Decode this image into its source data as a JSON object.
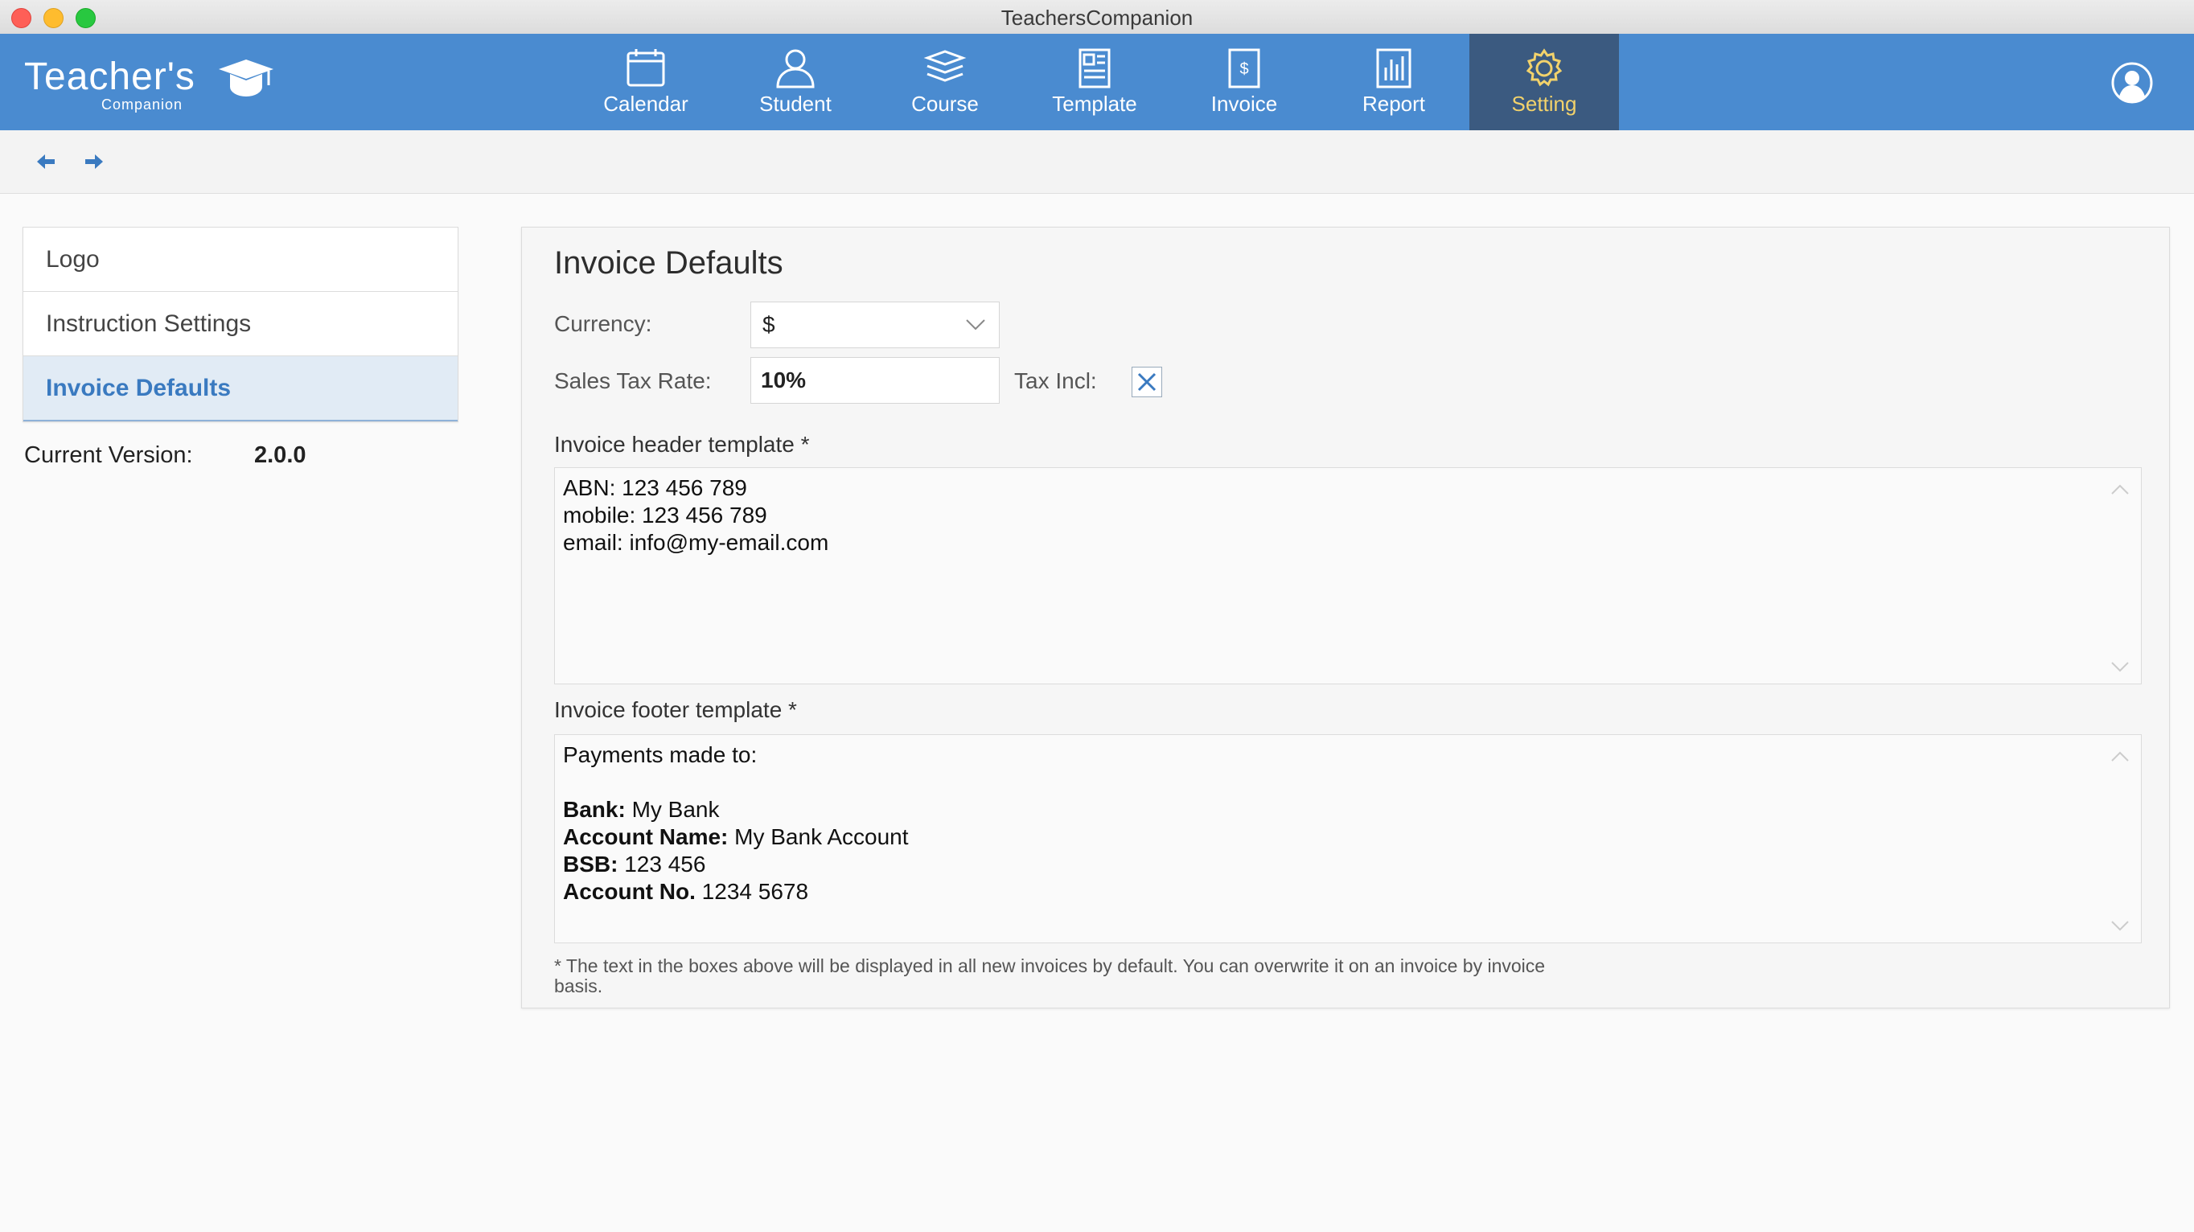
{
  "window": {
    "title": "TeachersCompanion"
  },
  "brand": {
    "name": "Teacher's",
    "subtitle": "Companion"
  },
  "nav": {
    "items": [
      {
        "label": "Calendar",
        "icon": "calendar-icon"
      },
      {
        "label": "Student",
        "icon": "student-icon"
      },
      {
        "label": "Course",
        "icon": "course-icon"
      },
      {
        "label": "Template",
        "icon": "template-icon"
      },
      {
        "label": "Invoice",
        "icon": "invoice-icon"
      },
      {
        "label": "Report",
        "icon": "report-icon"
      },
      {
        "label": "Setting",
        "icon": "gear-icon"
      }
    ],
    "active": "Setting"
  },
  "toolbar": {
    "back": "arrow-left-icon",
    "forward": "arrow-right-icon"
  },
  "sidebar": {
    "items": [
      {
        "label": "Logo"
      },
      {
        "label": "Instruction Settings"
      },
      {
        "label": "Invoice Defaults"
      }
    ],
    "active": "Invoice Defaults",
    "version_label": "Current Version:",
    "version_value": "2.0.0"
  },
  "invoice_defaults": {
    "title": "Invoice Defaults",
    "currency_label": "Currency:",
    "currency_value": "$",
    "tax_rate_label": "Sales Tax Rate:",
    "tax_rate_value": "10%",
    "tax_incl_label": "Tax Incl:",
    "tax_incl_checked": true,
    "header_label": "Invoice header template *",
    "header_lines": [
      "ABN: 123 456 789",
      "mobile: 123 456 789",
      "email: info@my-email.com"
    ],
    "footer_label": "Invoice footer template *",
    "footer_intro": "Payments made to:",
    "footer_lines": [
      {
        "key": "Bank:",
        "value": "My Bank"
      },
      {
        "key": "Account Name:",
        "value": "My Bank Account"
      },
      {
        "key": "BSB:",
        "value": "123 456"
      },
      {
        "key": "Account No.",
        "value": "1234 5678"
      }
    ],
    "note": "* The text in the boxes above will be displayed in all new invoices by default. You can overwrite it on an invoice by invoice basis."
  },
  "colors": {
    "nav_bg": "#4a8bd0",
    "nav_active_bg": "#3b5a80",
    "nav_active_text": "#f2d26b",
    "accent": "#3a7ac0"
  }
}
